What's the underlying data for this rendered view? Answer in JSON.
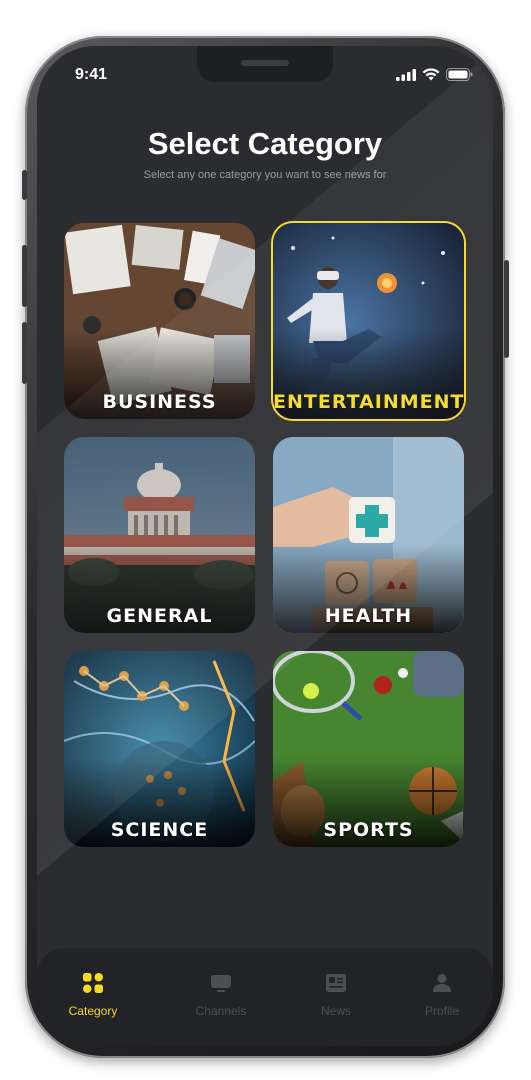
{
  "status_bar": {
    "time": "9:41"
  },
  "header": {
    "title": "Select Category",
    "subtitle": "Select any one category you want to see news for"
  },
  "categories": [
    {
      "label": "BUSINESS",
      "selected": false
    },
    {
      "label": "ENTERTAINMENT",
      "selected": true
    },
    {
      "label": "GENERAL",
      "selected": false
    },
    {
      "label": "HEALTH",
      "selected": false
    },
    {
      "label": "SCIENCE",
      "selected": false
    },
    {
      "label": "SPORTS",
      "selected": false
    }
  ],
  "bottom_nav": [
    {
      "label": "Category",
      "icon": "grid-icon",
      "active": true
    },
    {
      "label": "Channels",
      "icon": "tv-icon",
      "active": false
    },
    {
      "label": "News",
      "icon": "newspaper-icon",
      "active": false
    },
    {
      "label": "Profile",
      "icon": "user-icon",
      "active": false
    }
  ],
  "colors": {
    "accent": "#f5d922",
    "background": "#2b2c2f",
    "nav_background": "#222326",
    "inactive": "#4d4e52"
  }
}
